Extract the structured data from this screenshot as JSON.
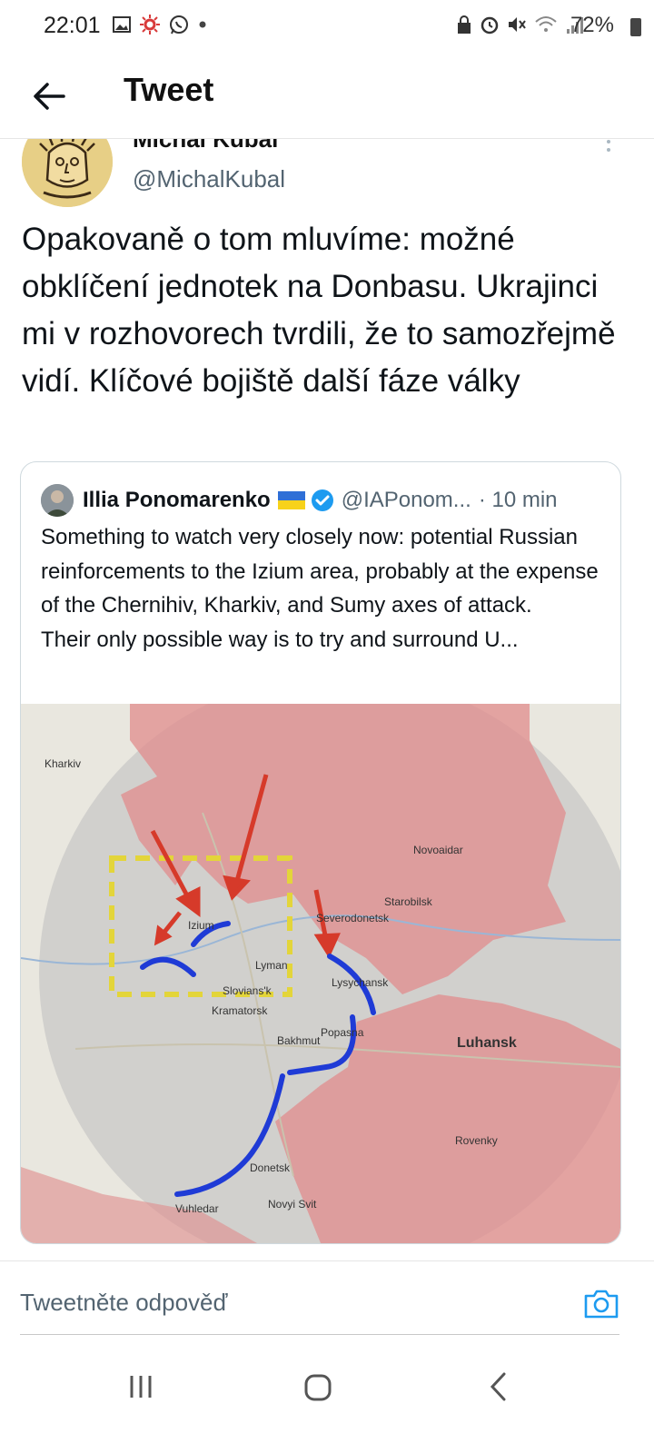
{
  "status_bar": {
    "time": "22:01",
    "battery": "72%",
    "left_icons": [
      "image-icon",
      "settings-burst-icon",
      "whatsapp-icon",
      "dot-icon"
    ],
    "right_icons": [
      "lock-icon",
      "alarm-icon",
      "mute-icon",
      "wifi-icon",
      "signal-icon",
      "battery-icon"
    ]
  },
  "header": {
    "title": "Tweet"
  },
  "tweet": {
    "author_name": "Michal Kubal",
    "author_handle": "@MichalKubal",
    "text": "Opakovaně o tom mluvíme: možné obklíčení jednotek na Donbasu. Ukrajinci mi v rozhovorech tvrdili, že to samozřejmě vidí. Klíčové bojiště další fáze války"
  },
  "quote": {
    "author_name": "Illia Ponomarenko",
    "author_handle": "@IAPonom...",
    "time": "· 10 min",
    "text": "Something to watch very closely now: potential Russian reinforcements to the Izium area, probably at the expense of the Chernihiv, Kharkiv, and Sumy axes of attack.\nTheir only possible way is to try and surround U...",
    "map_labels": {
      "kharkiv": "Kharkiv",
      "izium": "Izium",
      "severodonetsk": "Severodonetsk",
      "luhansk": "Luhansk",
      "kramatorsk": "Kramatorsk",
      "sloviansk": "Slovians'k",
      "lysychansk": "Lysychansk",
      "donetsk": "Donetsk",
      "starobilsk": "Starobilsk",
      "lyman": "Lyman",
      "bakhmut": "Bakhmut",
      "popasna": "Popasna",
      "vuhledar": "Vuhledar",
      "novyi_svit": "Novyi Svit",
      "rovenky": "Rovenky",
      "novoaidar": "Novoaidar"
    },
    "colors": {
      "occupied": "#e08c8c",
      "arrow": "#d63a2a",
      "pincer": "#1f3bd6",
      "box": "#e3d53a"
    }
  },
  "reply": {
    "placeholder": "Tweetněte odpověď"
  },
  "colors": {
    "accent": "#1d9bf0",
    "text_secondary": "#536471"
  }
}
